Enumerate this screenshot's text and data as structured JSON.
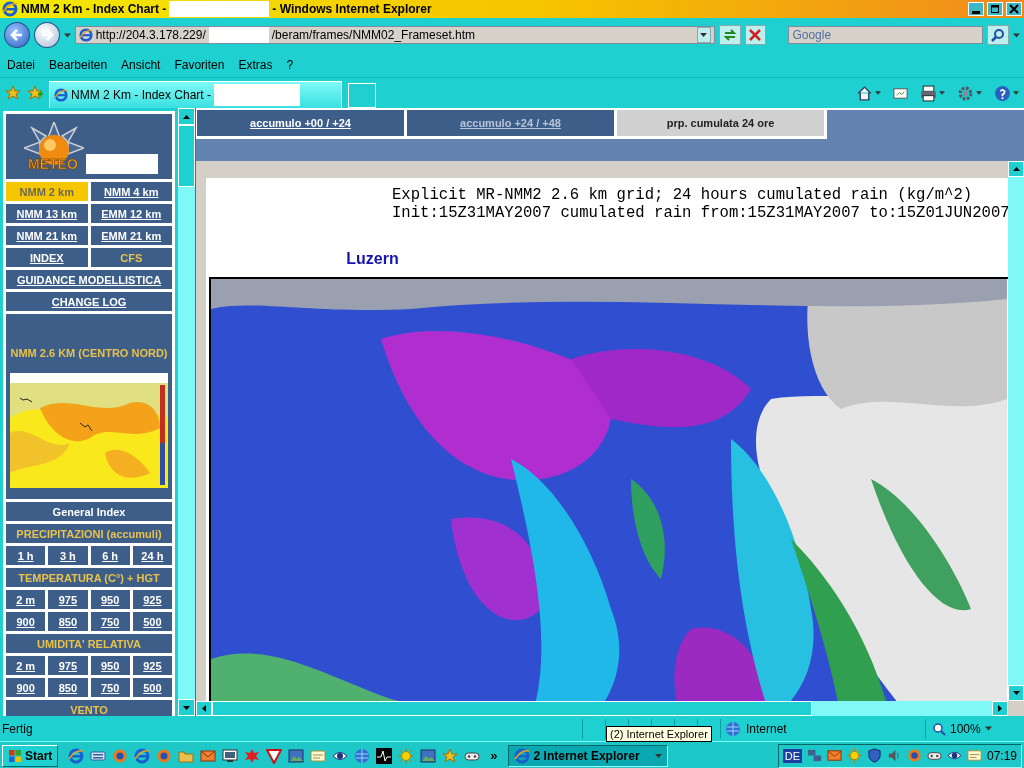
{
  "window": {
    "title": "NMM 2 Km - Index Chart -",
    "title_suffix": "- Windows Internet Explorer"
  },
  "address_bar": {
    "url_start": "http://204.3.178.229/",
    "url_end": "/beram/frames/NMM02_Frameset.htm"
  },
  "search": {
    "placeholder": "Google"
  },
  "menu": [
    "Datei",
    "Bearbeiten",
    "Ansicht",
    "Favoriten",
    "Extras",
    "?"
  ],
  "browser_tabs": [
    {
      "label": "NMM 2 Km - Index Chart -",
      "selected": true
    }
  ],
  "sidebar": {
    "logo_text": "METEO",
    "rows": [
      [
        {
          "label": "NMM 2 km",
          "kind": "link",
          "selected": true
        },
        {
          "label": "NMM 4 km",
          "kind": "link",
          "selected": false
        }
      ],
      [
        {
          "label": "NMM 13 km",
          "kind": "link",
          "selected": false
        },
        {
          "label": "EMM 12 km",
          "kind": "link",
          "selected": false
        }
      ],
      [
        {
          "label": "NMM 21 km",
          "kind": "link",
          "selected": false
        },
        {
          "label": "EMM 21 km",
          "kind": "link",
          "selected": false
        }
      ],
      [
        {
          "label": "INDEX",
          "kind": "link",
          "selected": false
        },
        {
          "label": "CFS",
          "kind": "heading"
        }
      ],
      [
        {
          "label": "GUIDANCE MODELLISTICA",
          "kind": "link",
          "selected": false
        }
      ],
      [
        {
          "label": "CHANGE LOG",
          "kind": "link",
          "selected": false
        }
      ],
      [
        {
          "label": "NMM 2.6 KM (CENTRO NORD)",
          "kind": "preview"
        }
      ],
      [
        {
          "label": "General Index",
          "kind": "label"
        }
      ],
      [
        {
          "label": "PRECIPITAZIONI (accumuli)",
          "kind": "heading"
        }
      ],
      [
        {
          "label": "1 h",
          "kind": "link",
          "selected": false
        },
        {
          "label": "3 h",
          "kind": "link",
          "selected": false
        },
        {
          "label": "6 h",
          "kind": "link",
          "selected": false
        },
        {
          "label": "24 h",
          "kind": "link",
          "selected": false
        }
      ],
      [
        {
          "label": "TEMPERATURA (C°) + HGT",
          "kind": "heading"
        }
      ],
      [
        {
          "label": "2 m",
          "kind": "link",
          "selected": false
        },
        {
          "label": "975",
          "kind": "link",
          "selected": false
        },
        {
          "label": "950",
          "kind": "link",
          "selected": false
        },
        {
          "label": "925",
          "kind": "link",
          "selected": false
        }
      ],
      [
        {
          "label": "900",
          "kind": "link",
          "selected": false
        },
        {
          "label": "850",
          "kind": "link",
          "selected": false
        },
        {
          "label": "750",
          "kind": "link",
          "selected": false
        },
        {
          "label": "500",
          "kind": "link",
          "selected": false
        }
      ],
      [
        {
          "label": "UMIDITA' RELATIVA",
          "kind": "heading"
        }
      ],
      [
        {
          "label": "2 m",
          "kind": "link",
          "selected": false
        },
        {
          "label": "975",
          "kind": "link",
          "selected": false
        },
        {
          "label": "950",
          "kind": "link",
          "selected": false
        },
        {
          "label": "925",
          "kind": "link",
          "selected": false
        }
      ],
      [
        {
          "label": "900",
          "kind": "link",
          "selected": false
        },
        {
          "label": "850",
          "kind": "link",
          "selected": false
        },
        {
          "label": "750",
          "kind": "link",
          "selected": false
        },
        {
          "label": "500",
          "kind": "link",
          "selected": false
        }
      ],
      [
        {
          "label": "VENTO",
          "kind": "heading"
        }
      ]
    ]
  },
  "frame_tabs": [
    {
      "label": "accumulo +00 / +24",
      "selected": false,
      "visited": false
    },
    {
      "label": "accumulo +24 / +48",
      "selected": false,
      "visited": true
    },
    {
      "label": "prp. cumulata 24 ore",
      "selected": true,
      "visited": false
    }
  ],
  "chart": {
    "title_lines": [
      "Explicit MR-NMM2 2.6 km grid; 24 hours cumulated rain (kg/m^2)",
      "Init:15Z31MAY2007 cumulated rain from:15Z31MAY2007 to:15Z01JUN2007"
    ],
    "place_label": "Luzern"
  },
  "status_bar": {
    "text": "Fertig",
    "zone": "Internet",
    "zoom": "100%",
    "tooltip": "(2) Internet Explorer"
  },
  "taskbar": {
    "start": "Start",
    "more": "»",
    "window_button": "2 Internet Explorer",
    "language": "DE",
    "clock": "07:19"
  }
}
